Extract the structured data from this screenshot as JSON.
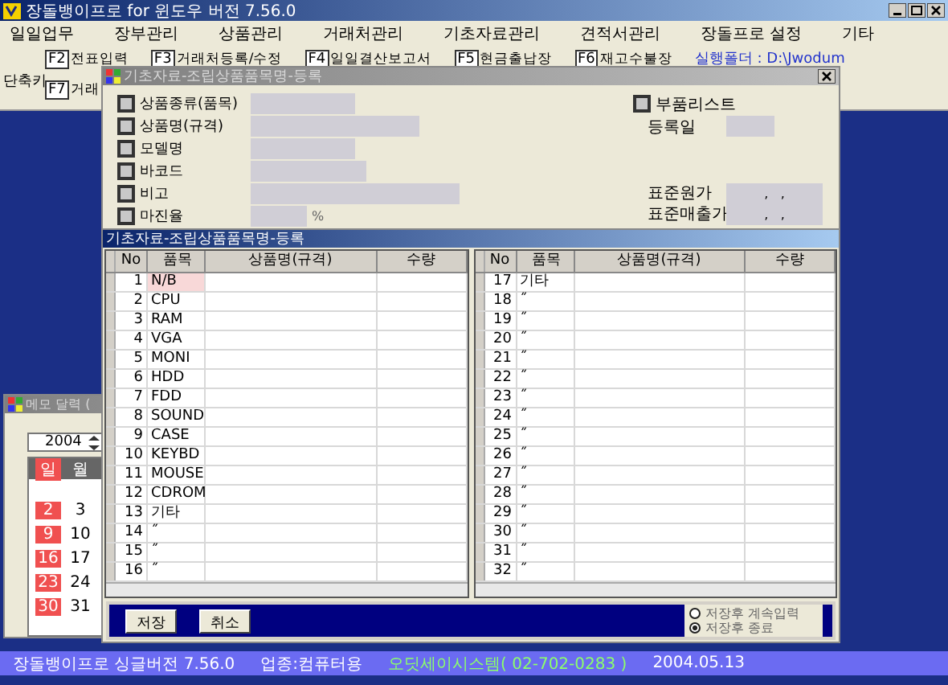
{
  "window": {
    "title": "장돌뱅이프로 for 윈도우 버전 7.56.0"
  },
  "menu": [
    "일일업무",
    "장부관리",
    "상품관리",
    "거래처관리",
    "기초자료관리",
    "견적서관리",
    "장돌프로 설정",
    "기타"
  ],
  "shortcuts": {
    "label": "단축키",
    "row1": [
      {
        "key": "F2",
        "label": "전표입력"
      },
      {
        "key": "F3",
        "label": "거래처등록/수정"
      },
      {
        "key": "F4",
        "label": "일일결산보고서"
      },
      {
        "key": "F5",
        "label": "현금출납장"
      },
      {
        "key": "F6",
        "label": "재고수불장"
      }
    ],
    "row2": [
      {
        "key": "F7",
        "label": "거래"
      }
    ],
    "folder": "실행폴더 : D:\\Jwodum"
  },
  "calendar": {
    "title": "메모 달력 (",
    "year": "2004",
    "days": [
      "일",
      "월"
    ],
    "weeks": [
      [
        "2",
        "3"
      ],
      [
        "9",
        "10"
      ],
      [
        "16",
        "17"
      ],
      [
        "23",
        "24"
      ],
      [
        "30",
        "31"
      ]
    ]
  },
  "form": {
    "title": "기초자료-조립상품품목명-등록",
    "fields": [
      {
        "label": "상품종류(품목)",
        "checked": false
      },
      {
        "label": "상품명(규격)",
        "checked": false
      },
      {
        "label": "모델명",
        "checked": false
      },
      {
        "label": "바코드",
        "checked": false
      },
      {
        "label": "비고",
        "checked": false
      },
      {
        "label": "마진율",
        "checked": false,
        "unit": "%"
      }
    ],
    "parts_list": {
      "label": "부품리스트",
      "checked": false
    },
    "reg_date": {
      "label": "등록일"
    },
    "prices": [
      {
        "label": "표준원가",
        "value": ",   ,"
      },
      {
        "label": "표준매출가",
        "value": ",   ,"
      }
    ]
  },
  "list": {
    "title": "기초자료-조립상품품목명-등록",
    "tables": [
      {
        "columns": [
          "No",
          "품목",
          "상품명(규격)",
          "수량"
        ],
        "rows": [
          {
            "no": "1",
            "item": "N/B",
            "selected": true
          },
          {
            "no": "2",
            "item": "CPU",
            "selected": false
          },
          {
            "no": "3",
            "item": "RAM",
            "selected": false
          },
          {
            "no": "4",
            "item": "VGA",
            "selected": false
          },
          {
            "no": "5",
            "item": "MONI",
            "selected": false
          },
          {
            "no": "6",
            "item": "HDD",
            "selected": false
          },
          {
            "no": "7",
            "item": "FDD",
            "selected": false
          },
          {
            "no": "8",
            "item": "SOUND",
            "selected": false
          },
          {
            "no": "9",
            "item": "CASE",
            "selected": false
          },
          {
            "no": "10",
            "item": "KEYBD",
            "selected": false
          },
          {
            "no": "11",
            "item": "MOUSE",
            "selected": false
          },
          {
            "no": "12",
            "item": "CDROM",
            "selected": false
          },
          {
            "no": "13",
            "item": "기타",
            "selected": false
          },
          {
            "no": "14",
            "item": "˝",
            "selected": false
          },
          {
            "no": "15",
            "item": "˝",
            "selected": false
          },
          {
            "no": "16",
            "item": "˝",
            "selected": false
          }
        ]
      },
      {
        "columns": [
          "No",
          "품목",
          "상품명(규격)",
          "수량"
        ],
        "rows": [
          {
            "no": "17",
            "item": "기타",
            "selected": false
          },
          {
            "no": "18",
            "item": "˝",
            "selected": false
          },
          {
            "no": "19",
            "item": "˝",
            "selected": false
          },
          {
            "no": "20",
            "item": "˝",
            "selected": false
          },
          {
            "no": "21",
            "item": "˝",
            "selected": false
          },
          {
            "no": "22",
            "item": "˝",
            "selected": false
          },
          {
            "no": "23",
            "item": "˝",
            "selected": false
          },
          {
            "no": "24",
            "item": "˝",
            "selected": false
          },
          {
            "no": "25",
            "item": "˝",
            "selected": false
          },
          {
            "no": "26",
            "item": "˝",
            "selected": false
          },
          {
            "no": "27",
            "item": "˝",
            "selected": false
          },
          {
            "no": "28",
            "item": "˝",
            "selected": false
          },
          {
            "no": "29",
            "item": "˝",
            "selected": false
          },
          {
            "no": "30",
            "item": "˝",
            "selected": false
          },
          {
            "no": "31",
            "item": "˝",
            "selected": false
          },
          {
            "no": "32",
            "item": "˝",
            "selected": false
          }
        ]
      }
    ],
    "buttons": [
      "저장",
      "취소"
    ],
    "after_save": [
      {
        "label": "저장후 계속입력",
        "selected": false
      },
      {
        "label": "저장후 종료",
        "selected": true
      }
    ]
  },
  "status_bar": {
    "product": "장돌뱅이프로 싱글버전 7.56.0",
    "business": "업종:컴퓨터용",
    "company": "오딧세이시스템( 02-702-0283 )",
    "date": "2004.05.13"
  }
}
